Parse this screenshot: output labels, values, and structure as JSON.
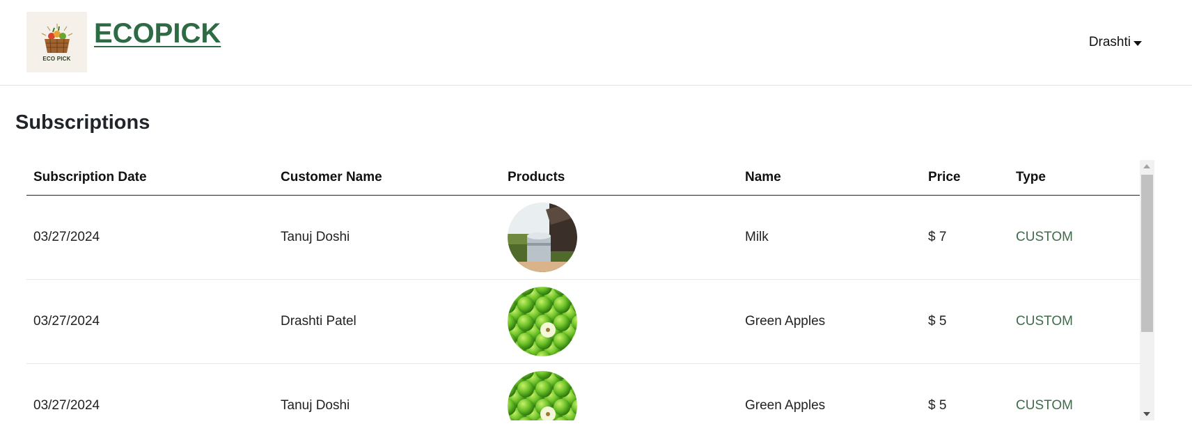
{
  "header": {
    "logo_caption": "ECO PICK",
    "brand": "ECOPICK",
    "user_name": "Drashti",
    "logo_icon": "basket-logo-icon",
    "brand_color": "#2e6b45"
  },
  "page": {
    "title": "Subscriptions"
  },
  "table": {
    "columns": [
      "Subscription Date",
      "Customer Name",
      "Products",
      "Name",
      "Price",
      "Type"
    ],
    "rows": [
      {
        "date": "03/27/2024",
        "customer": "Tanuj Doshi",
        "product_image": "milk-image",
        "name": "Milk",
        "price": "$ 7",
        "type": "CUSTOM"
      },
      {
        "date": "03/27/2024",
        "customer": "Drashti Patel",
        "product_image": "green-apples-image",
        "name": "Green Apples",
        "price": "$ 5",
        "type": "CUSTOM"
      },
      {
        "date": "03/27/2024",
        "customer": "Tanuj Doshi",
        "product_image": "green-apples-image",
        "name": "Green Apples",
        "price": "$ 5",
        "type": "CUSTOM"
      }
    ],
    "type_color": "#3f6b4a"
  }
}
